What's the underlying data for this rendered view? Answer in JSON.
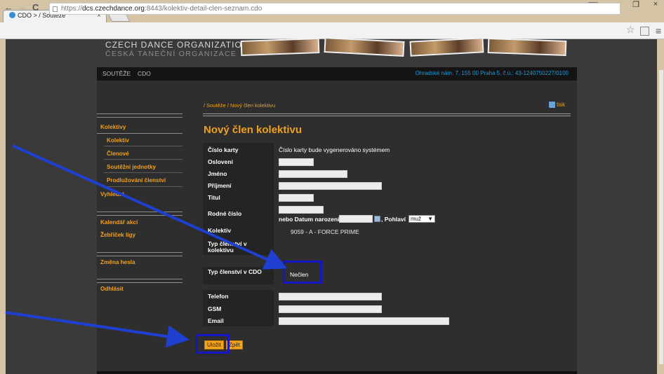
{
  "browser": {
    "tab_title": "CDO > / Soutěže",
    "tab_close": "×",
    "url_prefix": "https://",
    "url_host": "dcs.czechdance.org",
    "url_rest": ":8443/kolektiv-detail-clen-seznam.cdo",
    "nav_back": "←",
    "nav_forward": "→",
    "nav_reload": "C",
    "win_min": "–",
    "win_max": "❐",
    "win_close": "×",
    "star": "☆",
    "menu": "≡"
  },
  "header": {
    "logo_line1": "CZECH DANCE ORGANIZATION",
    "logo_line2": "ČESKÁ TANEČNÍ ORGANIZACE"
  },
  "topnav": {
    "items": [
      "SOUTĚŽE",
      "CDO"
    ],
    "address": "Ohradské nám. 7, 155 00 Praha 5, č.ú.: 43-1240750227/0100"
  },
  "breadcrumb": "/ Soutěže / Nový člen kolektivu",
  "print_label": "tisk",
  "sidebar": {
    "kolektivy": "Kolektivy",
    "sub": [
      "Kolektiv",
      "Členové",
      "Soutěžní jednotky",
      "Prodlužování členství"
    ],
    "vyhledat": "Vyhledat",
    "kalendar": "Kalendář akcí",
    "zebricek": "Žebříček ligy",
    "zmena_hesla": "Změna hesla",
    "odhlasit": "Odhlásit"
  },
  "form": {
    "title": "Nový člen kolektivu",
    "labels": {
      "cislo_karty": "Číslo karty",
      "osloveni": "Oslovení",
      "jmeno": "Jméno",
      "prijmeni": "Příjmení",
      "titul": "Titul",
      "rodne_cislo": "Rodné číslo",
      "kolektiv": "Kolektiv",
      "typ_clenstvi_kolektiv": "Typ členství v kolektivu",
      "typ_clenstvi_cdo": "Typ členství v CDO",
      "telefon": "Telefon",
      "gsm": "GSM",
      "email": "Email"
    },
    "cislo_karty_value": "Číslo karty bude vygenerováno systémem",
    "nebo_datum": "nebo Datum narození",
    "pohlavi_label": ", Pohlaví",
    "pohlavi_value": "muž",
    "kolektiv_value": "9059 - A - FORCE PRIME",
    "typ_cdo_value": "Nečlen",
    "save_label": "Uložit",
    "back_label": "Zpět"
  }
}
